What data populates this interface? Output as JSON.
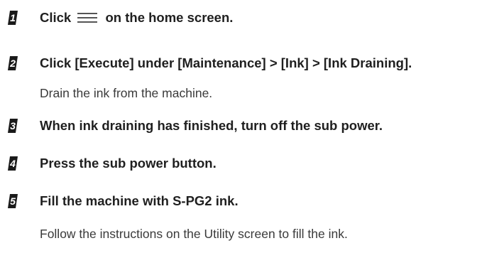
{
  "steps": [
    {
      "number": "1",
      "text_before": "Click",
      "icon": "hamburger-menu-icon",
      "text_after": "on the home screen."
    },
    {
      "number": "2",
      "text": "Click [Execute] under [Maintenance] > [Ink] > [Ink Draining].",
      "note": "Drain the ink from the machine."
    },
    {
      "number": "3",
      "text": "When ink draining has finished, turn off the sub power."
    },
    {
      "number": "4",
      "text": "Press the sub power button."
    },
    {
      "number": "5",
      "text": "Fill the machine with S-PG2 ink.",
      "note": "Follow the instructions on the Utility screen to fill the ink."
    }
  ],
  "colors": {
    "badge": "#1a1a1a",
    "text": "#1f1f1f",
    "note": "#3a3a3a"
  }
}
